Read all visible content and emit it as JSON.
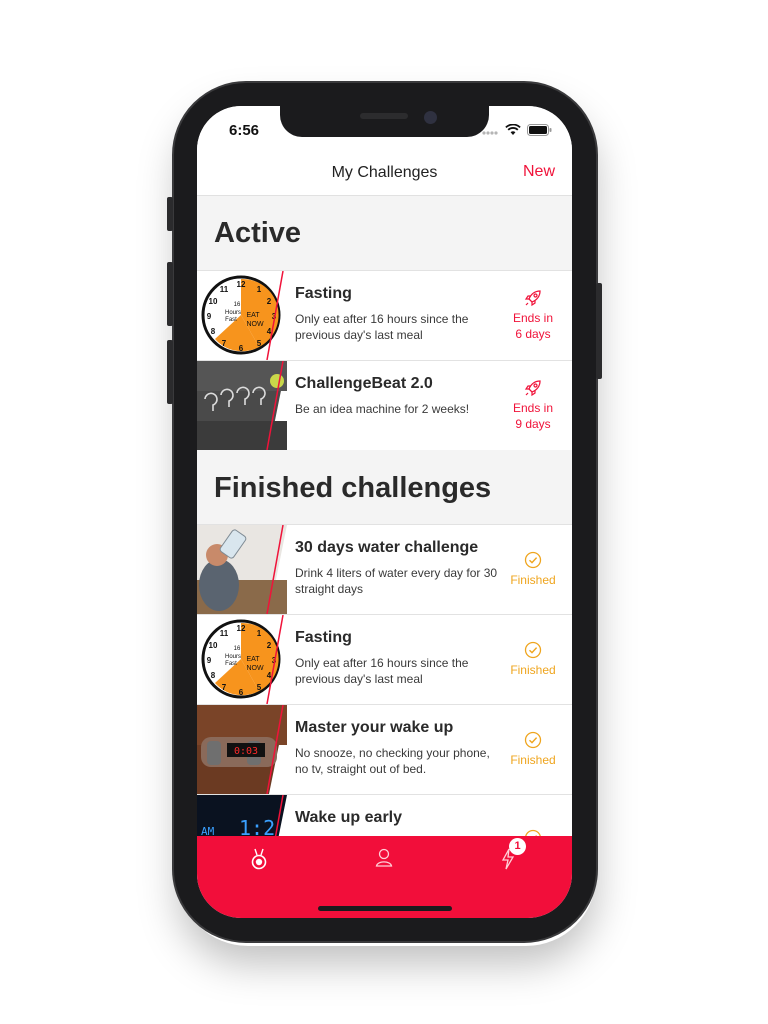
{
  "status_bar": {
    "time": "6:56"
  },
  "nav": {
    "title": "My Challenges",
    "new_label": "New"
  },
  "sections": {
    "active_title": "Active",
    "finished_title": "Finished challenges"
  },
  "active": [
    {
      "title": "Fasting",
      "description": "Only eat after 16 hours since the previous day's last meal",
      "status_line1": "Ends in",
      "status_line2": "6 days",
      "thumb": "clock"
    },
    {
      "title": "ChallengeBeat 2.0",
      "description": "Be an idea machine for 2 weeks!",
      "status_line1": "Ends in",
      "status_line2": "9 days",
      "thumb": "bulbs"
    }
  ],
  "finished": [
    {
      "title": "30 days water challenge",
      "description": "Drink 4 liters of water every day for 30 straight days",
      "status": "Finished",
      "thumb": "water"
    },
    {
      "title": "Fasting",
      "description": "Only eat after 16 hours since the previous day's last meal",
      "status": "Finished",
      "thumb": "clock"
    },
    {
      "title": "Master your wake up",
      "description": "No snooze, no checking your phone, no tv, straight out of bed.",
      "status": "Finished",
      "thumb": "bomb"
    },
    {
      "title": "Wake up early",
      "description": "",
      "status": "",
      "thumb": "alarm"
    }
  ],
  "clock_thumb": {
    "text1": "16",
    "text2": "Hours",
    "text3": "Fast",
    "text4": "EAT",
    "text5": "NOW",
    "alarm_display": "0:03",
    "alarm_label": "AM",
    "alarm_digits": "1:2"
  },
  "tab_bar": {
    "badge_count": "1"
  },
  "colors": {
    "accent": "#f0133a",
    "finished": "#efa51e",
    "tab_bar": "#f20e3a"
  },
  "icons": {
    "active_status": "rocket-icon",
    "finished_status": "check-circle-icon",
    "tab1": "medal-icon",
    "tab2": "profile-icon",
    "tab3": "lightning-icon"
  }
}
